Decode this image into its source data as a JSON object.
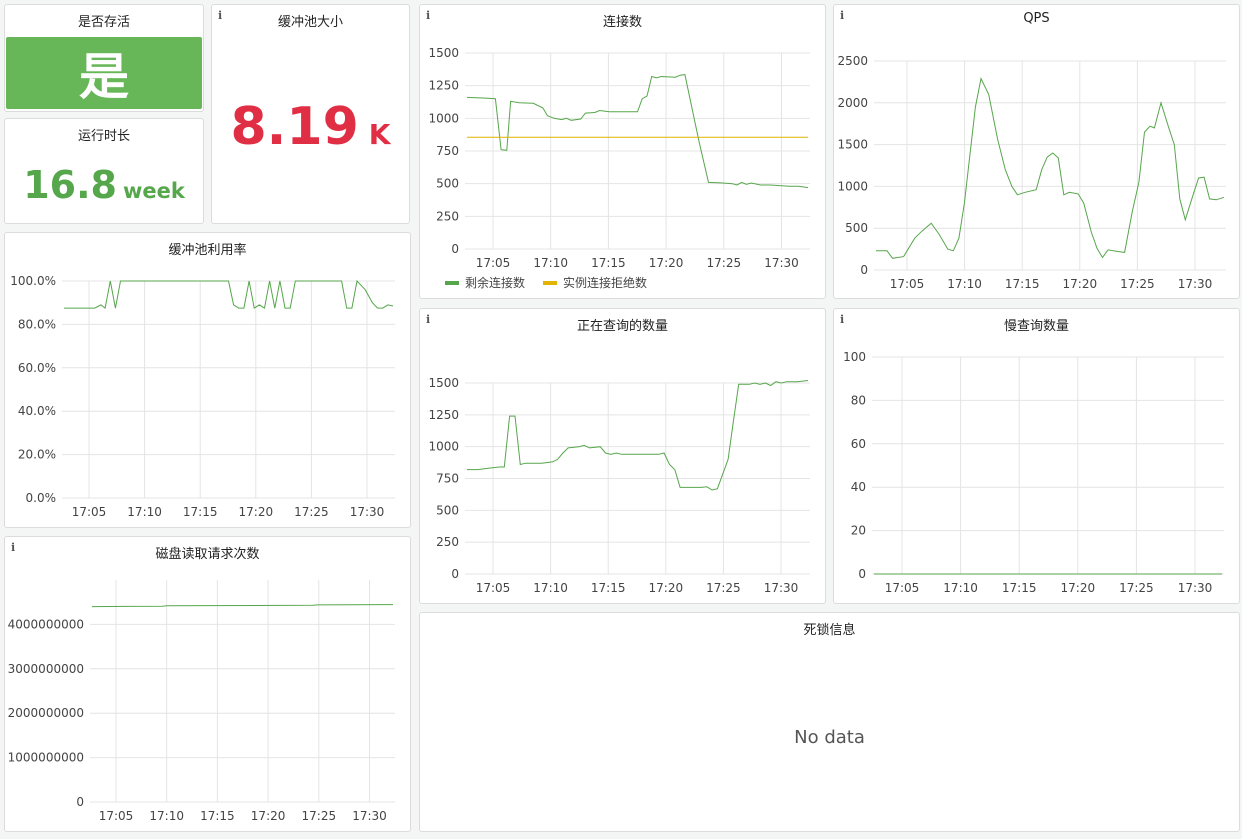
{
  "colors": {
    "green": "#56a64b",
    "yellow": "#e0b400",
    "red": "#e02f44",
    "grid": "#e4e4e4"
  },
  "panels": {
    "alive": {
      "title": "是否存活",
      "value": "是"
    },
    "bufsize": {
      "title": "缓冲池大小",
      "value": "8.19",
      "unit": "K"
    },
    "uptime": {
      "title": "运行时长",
      "value": "16.8",
      "unit": "week"
    },
    "deadlock": {
      "title": "死锁信息",
      "nodata": "No data"
    }
  },
  "chart_data": [
    {
      "id": "connections",
      "type": "line",
      "title": "连接数",
      "x_ticks": [
        "17:05",
        "17:10",
        "17:15",
        "17:20",
        "17:25",
        "17:30"
      ],
      "ylim": [
        0,
        1500
      ],
      "y_ticks": [
        "0",
        "250",
        "500",
        "750",
        "1000",
        "1250",
        "1500"
      ],
      "legend": "bottom-left",
      "series": [
        {
          "name": "剩余连接数",
          "color": "#56a64b",
          "points": [
            [
              0,
              1160
            ],
            [
              2,
              1155
            ],
            [
              3,
              1150
            ],
            [
              3.6,
              760
            ],
            [
              4.2,
              755
            ],
            [
              4.6,
              1130
            ],
            [
              5.5,
              1120
            ],
            [
              7,
              1115
            ],
            [
              8,
              1080
            ],
            [
              8.5,
              1020
            ],
            [
              9.2,
              1000
            ],
            [
              10,
              990
            ],
            [
              10.5,
              1000
            ],
            [
              11,
              985
            ],
            [
              12,
              995
            ],
            [
              12.5,
              1040
            ],
            [
              13.5,
              1045
            ],
            [
              14,
              1060
            ],
            [
              15,
              1050
            ],
            [
              18,
              1050
            ],
            [
              18.5,
              1150
            ],
            [
              19,
              1170
            ],
            [
              19.5,
              1320
            ],
            [
              20,
              1310
            ],
            [
              20.5,
              1320
            ],
            [
              22,
              1315
            ],
            [
              22.5,
              1330
            ],
            [
              23,
              1335
            ],
            [
              24.5,
              820
            ],
            [
              25.5,
              510
            ],
            [
              27,
              505
            ],
            [
              28,
              500
            ],
            [
              28.5,
              490
            ],
            [
              29,
              510
            ],
            [
              29.5,
              495
            ],
            [
              30,
              505
            ],
            [
              31,
              490
            ],
            [
              32,
              490
            ],
            [
              33,
              485
            ],
            [
              34,
              480
            ],
            [
              35,
              480
            ],
            [
              36,
              470
            ]
          ]
        },
        {
          "name": "实例连接拒绝数",
          "color": "#e0b400",
          "points": [
            [
              0,
              855
            ],
            [
              36,
              855
            ]
          ]
        }
      ]
    },
    {
      "id": "qps",
      "type": "line",
      "title": "QPS",
      "x_ticks": [
        "17:05",
        "17:10",
        "17:15",
        "17:20",
        "17:25",
        "17:30"
      ],
      "ylim": [
        0,
        2500
      ],
      "y_ticks": [
        "0",
        "500",
        "1000",
        "1500",
        "2000",
        "2500"
      ],
      "series": [
        {
          "name": "",
          "color": "#56a64b",
          "points": [
            [
              0,
              230
            ],
            [
              1,
              230
            ],
            [
              1.5,
              140
            ],
            [
              2.5,
              160
            ],
            [
              3.5,
              380
            ],
            [
              4.2,
              470
            ],
            [
              5,
              560
            ],
            [
              5.7,
              430
            ],
            [
              6.5,
              250
            ],
            [
              7,
              230
            ],
            [
              7.5,
              380
            ],
            [
              8,
              800
            ],
            [
              9,
              1950
            ],
            [
              9.5,
              2290
            ],
            [
              10.2,
              2100
            ],
            [
              11,
              1570
            ],
            [
              11.7,
              1200
            ],
            [
              12.3,
              1000
            ],
            [
              12.8,
              900
            ],
            [
              13.5,
              930
            ],
            [
              14.5,
              960
            ],
            [
              15,
              1200
            ],
            [
              15.5,
              1350
            ],
            [
              16,
              1400
            ],
            [
              16.5,
              1340
            ],
            [
              17,
              900
            ],
            [
              17.5,
              930
            ],
            [
              18.3,
              910
            ],
            [
              18.8,
              800
            ],
            [
              19.5,
              450
            ],
            [
              20,
              260
            ],
            [
              20.5,
              150
            ],
            [
              21,
              240
            ],
            [
              22,
              220
            ],
            [
              22.5,
              210
            ],
            [
              23.2,
              700
            ],
            [
              23.8,
              1050
            ],
            [
              24.3,
              1650
            ],
            [
              24.8,
              1720
            ],
            [
              25.2,
              1700
            ],
            [
              25.8,
              2000
            ],
            [
              26.5,
              1700
            ],
            [
              27,
              1500
            ],
            [
              27.5,
              850
            ],
            [
              28,
              600
            ],
            [
              28.7,
              900
            ],
            [
              29.2,
              1100
            ],
            [
              29.7,
              1110
            ],
            [
              30.2,
              850
            ],
            [
              30.8,
              840
            ],
            [
              31.5,
              870
            ]
          ]
        }
      ]
    },
    {
      "id": "bufusage",
      "type": "line",
      "title": "缓冲池利用率",
      "x_ticks": [
        "17:05",
        "17:10",
        "17:15",
        "17:20",
        "17:25",
        "17:30"
      ],
      "ylim": [
        0,
        100
      ],
      "y_ticks": [
        "0.0%",
        "20.0%",
        "40.0%",
        "60.0%",
        "80.0%",
        "100.0%"
      ],
      "series": [
        {
          "name": "",
          "color": "#56a64b",
          "points": [
            [
              0,
              87.5
            ],
            [
              3,
              87.5
            ],
            [
              3.6,
              89
            ],
            [
              4,
              87.5
            ],
            [
              4.5,
              100
            ],
            [
              5,
              87.5
            ],
            [
              5.5,
              100
            ],
            [
              16,
              100
            ],
            [
              16.5,
              89
            ],
            [
              17,
              87.5
            ],
            [
              17.5,
              87.5
            ],
            [
              18,
              100
            ],
            [
              18.5,
              87.5
            ],
            [
              19,
              89
            ],
            [
              19.5,
              87.5
            ],
            [
              20,
              100
            ],
            [
              20.5,
              87.5
            ],
            [
              21,
              100
            ],
            [
              21.5,
              87.5
            ],
            [
              22,
              87.5
            ],
            [
              22.5,
              100
            ],
            [
              27,
              100
            ],
            [
              27.5,
              87.5
            ],
            [
              28,
              87.5
            ],
            [
              28.5,
              100
            ],
            [
              29.3,
              96
            ],
            [
              30,
              90
            ],
            [
              30.5,
              87.5
            ],
            [
              31,
              87.5
            ],
            [
              31.5,
              89
            ],
            [
              32,
              88.5
            ]
          ]
        }
      ]
    },
    {
      "id": "running_queries",
      "type": "line",
      "title": "正在查询的数量",
      "x_ticks": [
        "17:05",
        "17:10",
        "17:15",
        "17:20",
        "17:25",
        "17:30"
      ],
      "ylim": [
        0,
        1500
      ],
      "y_ticks": [
        "0",
        "250",
        "500",
        "750",
        "1000",
        "1250",
        "1500"
      ],
      "series": [
        {
          "name": "",
          "color": "#56a64b",
          "points": [
            [
              0,
              820
            ],
            [
              1,
              820
            ],
            [
              2,
              830
            ],
            [
              3,
              840
            ],
            [
              3.5,
              840
            ],
            [
              4,
              1240
            ],
            [
              4.5,
              1240
            ],
            [
              5,
              860
            ],
            [
              5.5,
              870
            ],
            [
              7,
              870
            ],
            [
              8,
              880
            ],
            [
              8.5,
              900
            ],
            [
              9,
              950
            ],
            [
              9.5,
              990
            ],
            [
              10.5,
              1000
            ],
            [
              11,
              1010
            ],
            [
              11.5,
              990
            ],
            [
              12.5,
              1000
            ],
            [
              13,
              950
            ],
            [
              13.5,
              940
            ],
            [
              14,
              950
            ],
            [
              14.5,
              940
            ],
            [
              18,
              940
            ],
            [
              18.5,
              950
            ],
            [
              19,
              860
            ],
            [
              19.5,
              820
            ],
            [
              20,
              680
            ],
            [
              21,
              680
            ],
            [
              22,
              680
            ],
            [
              22.5,
              685
            ],
            [
              23,
              660
            ],
            [
              23.5,
              670
            ],
            [
              24.5,
              900
            ],
            [
              25,
              1200
            ],
            [
              25.5,
              1490
            ],
            [
              26.5,
              1490
            ],
            [
              27,
              1500
            ],
            [
              27.5,
              1490
            ],
            [
              28,
              1500
            ],
            [
              28.5,
              1480
            ],
            [
              29,
              1510
            ],
            [
              29.5,
              1500
            ],
            [
              30,
              1510
            ],
            [
              31,
              1510
            ],
            [
              32,
              1520
            ]
          ]
        }
      ]
    },
    {
      "id": "slow_queries",
      "type": "line",
      "title": "慢查询数量",
      "x_ticks": [
        "17:05",
        "17:10",
        "17:15",
        "17:20",
        "17:25",
        "17:30"
      ],
      "ylim": [
        0,
        100
      ],
      "y_ticks": [
        "0",
        "20",
        "40",
        "60",
        "80",
        "100"
      ],
      "series": [
        {
          "name": "",
          "color": "#56a64b",
          "points": [
            [
              0,
              0
            ],
            [
              31,
              0
            ]
          ]
        }
      ]
    },
    {
      "id": "disk_reads",
      "type": "line",
      "title": "磁盘读取请求次数",
      "x_ticks": [
        "17:05",
        "17:10",
        "17:15",
        "17:20",
        "17:25",
        "17:30"
      ],
      "ylim": [
        0,
        5000000000
      ],
      "y_ticks": [
        "0",
        "1000000000",
        "2000000000",
        "3000000000",
        "4000000000"
      ],
      "series": [
        {
          "name": "",
          "color": "#56a64b",
          "points": [
            [
              0,
              4400000000
            ],
            [
              7,
              4410000000
            ],
            [
              7.5,
              4420000000
            ],
            [
              22,
              4430000000
            ],
            [
              22.5,
              4440000000
            ],
            [
              30,
              4445000000
            ]
          ]
        }
      ]
    }
  ]
}
